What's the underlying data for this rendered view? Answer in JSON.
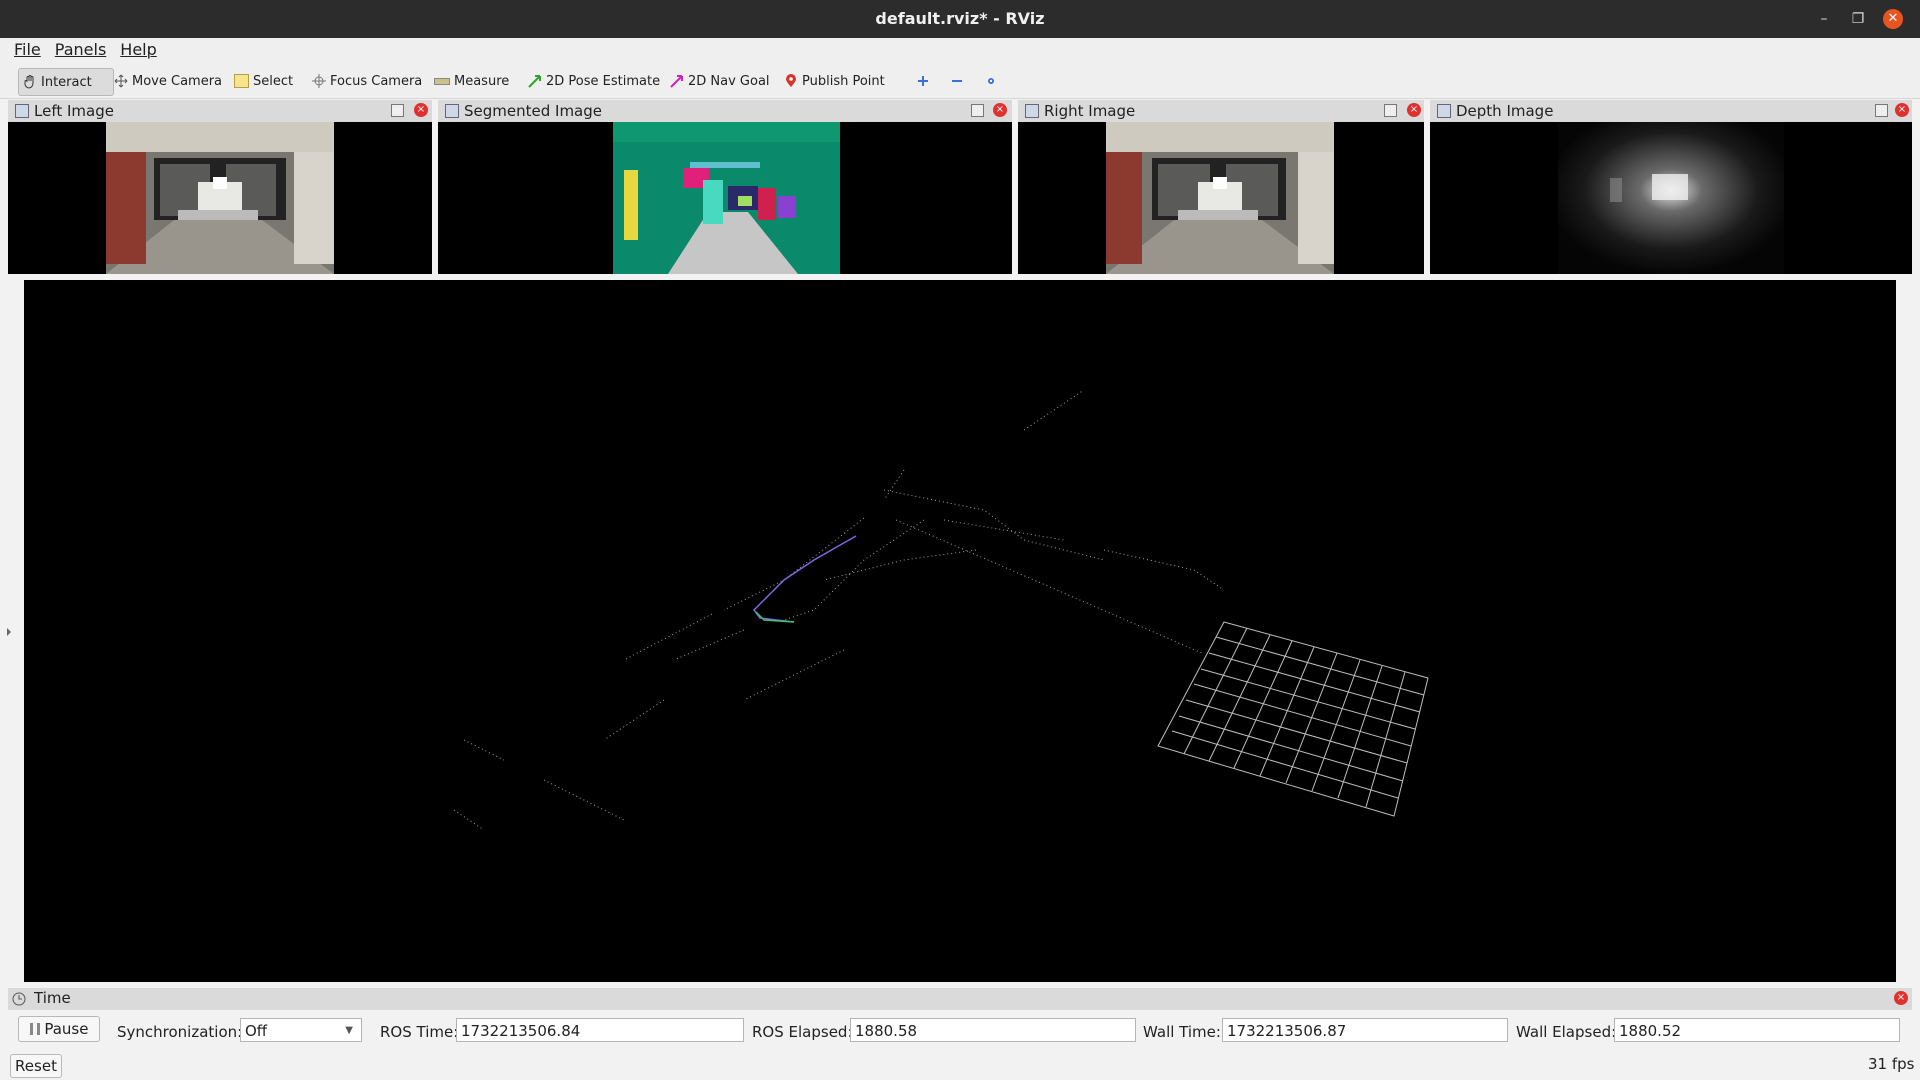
{
  "window": {
    "title": "default.rviz* - RViz"
  },
  "menu": {
    "file": "File",
    "panels": "Panels",
    "help": "Help"
  },
  "toolbar": {
    "interact": "Interact",
    "move_camera": "Move Camera",
    "select": "Select",
    "focus_camera": "Focus Camera",
    "measure": "Measure",
    "pose_estimate": "2D Pose Estimate",
    "nav_goal": "2D Nav Goal",
    "publish_point": "Publish Point"
  },
  "panels": {
    "left_image": "Left Image",
    "segmented_image": "Segmented Image",
    "right_image": "Right Image",
    "depth_image": "Depth Image"
  },
  "time_panel": {
    "title": "Time",
    "pause": "Pause",
    "sync_label": "Synchronization:",
    "sync_value": "Off",
    "ros_time_label": "ROS Time:",
    "ros_time": "1732213506.84",
    "ros_elapsed_label": "ROS Elapsed:",
    "ros_elapsed": "1880.58",
    "wall_time_label": "Wall Time:",
    "wall_time": "1732213506.87",
    "wall_elapsed_label": "Wall Elapsed:",
    "wall_elapsed": "1880.52"
  },
  "status": {
    "reset": "Reset",
    "fps": "31 fps"
  },
  "colors": {
    "close_red": "#e95420",
    "panel_bar": "#dadada",
    "viewport_bg": "#000000"
  }
}
